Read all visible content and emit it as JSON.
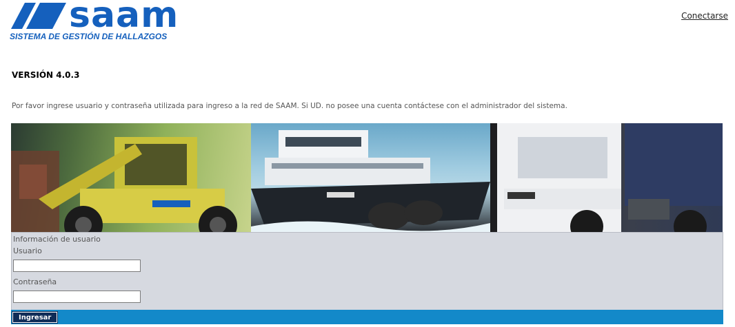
{
  "header": {
    "logo_word": "saam",
    "logo_subtitle": "SISTEMA DE GESTIÓN DE HALLAZGOS",
    "connect_link": "Conectarse"
  },
  "version_label": "VERSIÓN 4.0.3",
  "intro_text": "Por favor ingrese usuario y contraseña utilizada para ingreso a la red de SAAM. Si UD. no posee una cuenta contáctese con el administrador del sistema.",
  "banner": {
    "panels": [
      "forklift-machinery-image",
      "tugboat-image",
      "truck-image"
    ]
  },
  "login_form": {
    "section_title": "Información de usuario",
    "username_label": "Usuario",
    "username_value": "",
    "password_label": "Contraseña",
    "password_value": "",
    "submit_label": "Ingresar"
  },
  "colors": {
    "brand_blue": "#1560bd",
    "form_bg": "#d6d9e0",
    "bar_blue": "#1389c9",
    "button_bg": "#0f2c57"
  }
}
